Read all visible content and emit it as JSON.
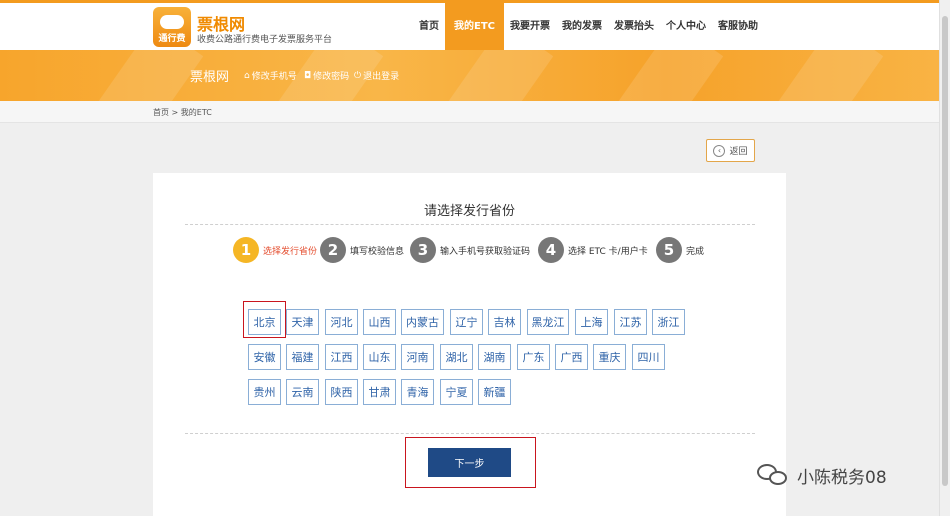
{
  "header": {
    "logo_text": "通行费",
    "brand": "票根网",
    "slogan": "收费公路通行费电子发票服务平台",
    "nav": [
      "首页",
      "我的ETC",
      "我要开票",
      "我的发票",
      "发票抬头",
      "个人中心",
      "客服协助"
    ],
    "active_nav": "我的ETC"
  },
  "banner": {
    "title": "票根网",
    "links": [
      "修改手机号",
      "修改密码",
      "退出登录"
    ]
  },
  "breadcrumb": "首页 > 我的ETC",
  "back_label": "返回",
  "panel": {
    "title": "请选择发行省份",
    "steps": [
      {
        "num": "1",
        "label": "选择发行省份"
      },
      {
        "num": "2",
        "label": "填写校验信息"
      },
      {
        "num": "3",
        "label": "输入手机号获取验证码"
      },
      {
        "num": "4",
        "label": "选择 ETC 卡/用户卡"
      },
      {
        "num": "5",
        "label": "完成"
      }
    ],
    "provinces": [
      [
        "北京",
        "天津",
        "河北",
        "山西",
        "内蒙古",
        "辽宁",
        "吉林",
        "黑龙江",
        "上海",
        "江苏",
        "浙江"
      ],
      [
        "安徽",
        "福建",
        "江西",
        "山东",
        "河南",
        "湖北",
        "湖南",
        "广东",
        "广西",
        "重庆",
        "四川"
      ],
      [
        "贵州",
        "云南",
        "陕西",
        "甘肃",
        "青海",
        "宁夏",
        "新疆"
      ]
    ],
    "selected_province": "北京",
    "next_label": "下一步"
  },
  "watermark": "小陈税务08",
  "colors": {
    "accent": "#f39b1f",
    "button": "#1f4a86",
    "province_border": "#8aaed6",
    "highlight": "#c9151e"
  }
}
